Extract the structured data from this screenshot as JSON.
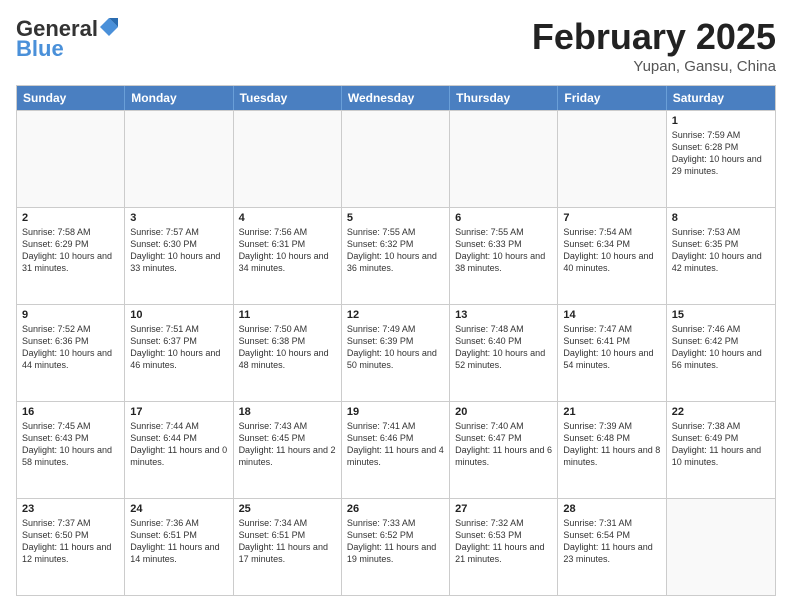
{
  "header": {
    "logo_general": "General",
    "logo_blue": "Blue",
    "month": "February 2025",
    "location": "Yupan, Gansu, China"
  },
  "days_of_week": [
    "Sunday",
    "Monday",
    "Tuesday",
    "Wednesday",
    "Thursday",
    "Friday",
    "Saturday"
  ],
  "weeks": [
    [
      {
        "day": "",
        "text": ""
      },
      {
        "day": "",
        "text": ""
      },
      {
        "day": "",
        "text": ""
      },
      {
        "day": "",
        "text": ""
      },
      {
        "day": "",
        "text": ""
      },
      {
        "day": "",
        "text": ""
      },
      {
        "day": "1",
        "text": "Sunrise: 7:59 AM\nSunset: 6:28 PM\nDaylight: 10 hours and 29 minutes."
      }
    ],
    [
      {
        "day": "2",
        "text": "Sunrise: 7:58 AM\nSunset: 6:29 PM\nDaylight: 10 hours and 31 minutes."
      },
      {
        "day": "3",
        "text": "Sunrise: 7:57 AM\nSunset: 6:30 PM\nDaylight: 10 hours and 33 minutes."
      },
      {
        "day": "4",
        "text": "Sunrise: 7:56 AM\nSunset: 6:31 PM\nDaylight: 10 hours and 34 minutes."
      },
      {
        "day": "5",
        "text": "Sunrise: 7:55 AM\nSunset: 6:32 PM\nDaylight: 10 hours and 36 minutes."
      },
      {
        "day": "6",
        "text": "Sunrise: 7:55 AM\nSunset: 6:33 PM\nDaylight: 10 hours and 38 minutes."
      },
      {
        "day": "7",
        "text": "Sunrise: 7:54 AM\nSunset: 6:34 PM\nDaylight: 10 hours and 40 minutes."
      },
      {
        "day": "8",
        "text": "Sunrise: 7:53 AM\nSunset: 6:35 PM\nDaylight: 10 hours and 42 minutes."
      }
    ],
    [
      {
        "day": "9",
        "text": "Sunrise: 7:52 AM\nSunset: 6:36 PM\nDaylight: 10 hours and 44 minutes."
      },
      {
        "day": "10",
        "text": "Sunrise: 7:51 AM\nSunset: 6:37 PM\nDaylight: 10 hours and 46 minutes."
      },
      {
        "day": "11",
        "text": "Sunrise: 7:50 AM\nSunset: 6:38 PM\nDaylight: 10 hours and 48 minutes."
      },
      {
        "day": "12",
        "text": "Sunrise: 7:49 AM\nSunset: 6:39 PM\nDaylight: 10 hours and 50 minutes."
      },
      {
        "day": "13",
        "text": "Sunrise: 7:48 AM\nSunset: 6:40 PM\nDaylight: 10 hours and 52 minutes."
      },
      {
        "day": "14",
        "text": "Sunrise: 7:47 AM\nSunset: 6:41 PM\nDaylight: 10 hours and 54 minutes."
      },
      {
        "day": "15",
        "text": "Sunrise: 7:46 AM\nSunset: 6:42 PM\nDaylight: 10 hours and 56 minutes."
      }
    ],
    [
      {
        "day": "16",
        "text": "Sunrise: 7:45 AM\nSunset: 6:43 PM\nDaylight: 10 hours and 58 minutes."
      },
      {
        "day": "17",
        "text": "Sunrise: 7:44 AM\nSunset: 6:44 PM\nDaylight: 11 hours and 0 minutes."
      },
      {
        "day": "18",
        "text": "Sunrise: 7:43 AM\nSunset: 6:45 PM\nDaylight: 11 hours and 2 minutes."
      },
      {
        "day": "19",
        "text": "Sunrise: 7:41 AM\nSunset: 6:46 PM\nDaylight: 11 hours and 4 minutes."
      },
      {
        "day": "20",
        "text": "Sunrise: 7:40 AM\nSunset: 6:47 PM\nDaylight: 11 hours and 6 minutes."
      },
      {
        "day": "21",
        "text": "Sunrise: 7:39 AM\nSunset: 6:48 PM\nDaylight: 11 hours and 8 minutes."
      },
      {
        "day": "22",
        "text": "Sunrise: 7:38 AM\nSunset: 6:49 PM\nDaylight: 11 hours and 10 minutes."
      }
    ],
    [
      {
        "day": "23",
        "text": "Sunrise: 7:37 AM\nSunset: 6:50 PM\nDaylight: 11 hours and 12 minutes."
      },
      {
        "day": "24",
        "text": "Sunrise: 7:36 AM\nSunset: 6:51 PM\nDaylight: 11 hours and 14 minutes."
      },
      {
        "day": "25",
        "text": "Sunrise: 7:34 AM\nSunset: 6:51 PM\nDaylight: 11 hours and 17 minutes."
      },
      {
        "day": "26",
        "text": "Sunrise: 7:33 AM\nSunset: 6:52 PM\nDaylight: 11 hours and 19 minutes."
      },
      {
        "day": "27",
        "text": "Sunrise: 7:32 AM\nSunset: 6:53 PM\nDaylight: 11 hours and 21 minutes."
      },
      {
        "day": "28",
        "text": "Sunrise: 7:31 AM\nSunset: 6:54 PM\nDaylight: 11 hours and 23 minutes."
      },
      {
        "day": "",
        "text": ""
      }
    ]
  ]
}
